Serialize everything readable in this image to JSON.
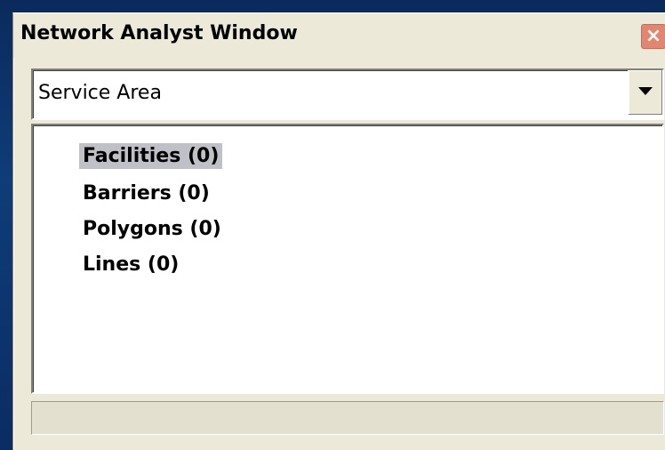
{
  "window": {
    "title": "Network Analyst Window",
    "close_glyph": "×"
  },
  "combo": {
    "selected": "Service Area"
  },
  "tree": {
    "items": [
      {
        "label": "Facilities (0)",
        "selected": true
      },
      {
        "label": "Barriers (0)",
        "selected": false
      },
      {
        "label": "Polygons (0)",
        "selected": false
      },
      {
        "label": "Lines (0)",
        "selected": false
      }
    ]
  },
  "status": {
    "text": ""
  },
  "icons": {
    "close": "close-icon",
    "dropdown": "chevron-down-icon"
  }
}
